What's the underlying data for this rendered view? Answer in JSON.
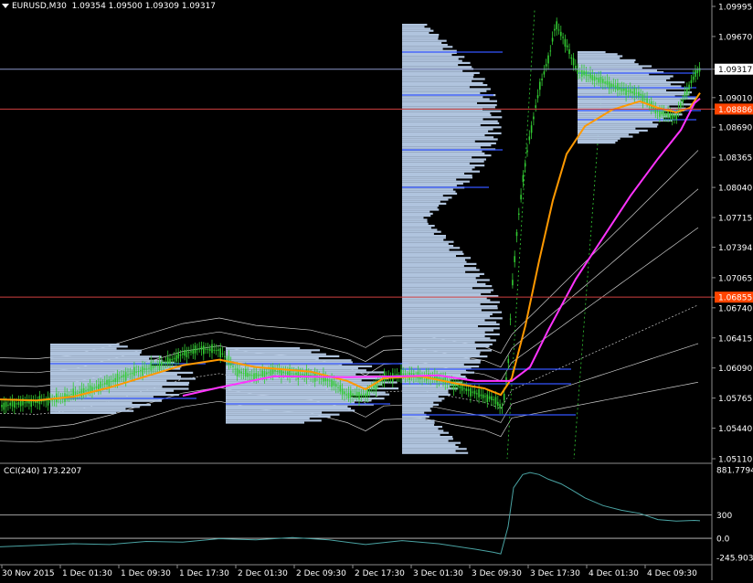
{
  "window": {
    "symbol": "EURUSD,M30",
    "ohlc": "1.09354 1.09500 1.09309 1.09317"
  },
  "indicator": {
    "title": "CCI(240) 173.2207"
  },
  "colors": {
    "background": "#000000",
    "bull_candle": "#33cc33",
    "profile_fill": "#b0c4de",
    "poc_line": "#3355ff",
    "orange_ma": "#ff9900",
    "magenta_ma": "#ff33ff",
    "horizontal_red": "#d04040",
    "current_price_line": "#8a96c8",
    "envelope": "#ffffff",
    "cci_line": "#4aa3a3",
    "red_label_bg": "#ff4400"
  },
  "chart_data": [
    {
      "type": "line",
      "name": "price-chart",
      "y_axis_ticks": [
        "1.09995",
        "1.09670",
        "1.09317",
        "1.09010",
        "1.08886",
        "1.08690",
        "1.08365",
        "1.08040",
        "1.07715",
        "1.07394",
        "1.07065",
        "1.06855",
        "1.06740",
        "1.06415",
        "1.06090",
        "1.05765",
        "1.05440",
        "1.05110"
      ],
      "highlighted_prices": {
        "current": "1.09317",
        "red_level_1": "1.08886",
        "red_level_2": "1.06855"
      },
      "x_axis_ticks": [
        "30 Nov 2015",
        "1 Dec 01:30",
        "1 Dec 09:30",
        "1 Dec 17:30",
        "2 Dec 01:30",
        "2 Dec 09:30",
        "2 Dec 17:30",
        "3 Dec 01:30",
        "3 Dec 09:30",
        "3 Dec 17:30",
        "4 Dec 01:30",
        "4 Dec 09:30"
      ],
      "ylim": [
        1.0511,
        1.09995
      ],
      "close_path": [
        [
          0,
          1.0568
        ],
        [
          20,
          1.0571
        ],
        [
          40,
          1.0573
        ],
        [
          60,
          1.0575
        ],
        [
          80,
          1.0581
        ],
        [
          100,
          1.0586
        ],
        [
          120,
          1.0594
        ],
        [
          140,
          1.0602
        ],
        [
          160,
          1.0608
        ],
        [
          180,
          1.0614
        ],
        [
          200,
          1.0624
        ],
        [
          220,
          1.063
        ],
        [
          240,
          1.0628
        ],
        [
          260,
          1.0605
        ],
        [
          280,
          1.06
        ],
        [
          300,
          1.0606
        ],
        [
          320,
          1.0603
        ],
        [
          340,
          1.0601
        ],
        [
          360,
          1.0596
        ],
        [
          380,
          1.058
        ],
        [
          400,
          1.058
        ],
        [
          420,
          1.0598
        ],
        [
          440,
          1.0602
        ],
        [
          460,
          1.06
        ],
        [
          480,
          1.0598
        ],
        [
          500,
          1.059
        ],
        [
          520,
          1.0582
        ],
        [
          540,
          1.0575
        ],
        [
          550,
          1.0566
        ],
        [
          556,
          1.061
        ],
        [
          560,
          1.069
        ],
        [
          566,
          1.076
        ],
        [
          572,
          1.081
        ],
        [
          578,
          1.085
        ],
        [
          584,
          1.088
        ],
        [
          590,
          1.091
        ],
        [
          596,
          1.093
        ],
        [
          602,
          1.095
        ],
        [
          608,
          1.098
        ],
        [
          614,
          1.097
        ],
        [
          620,
          1.0958
        ],
        [
          626,
          1.0942
        ],
        [
          632,
          1.093
        ],
        [
          680,
          1.091
        ],
        [
          700,
          1.0905
        ],
        [
          720,
          1.0885
        ],
        [
          740,
          1.088
        ],
        [
          750,
          1.0905
        ],
        [
          760,
          1.0925
        ],
        [
          766,
          1.0932
        ]
      ],
      "orange_ma": [
        [
          0,
          1.0575
        ],
        [
          40,
          1.0574
        ],
        [
          80,
          1.0578
        ],
        [
          120,
          1.0588
        ],
        [
          160,
          1.06
        ],
        [
          200,
          1.0612
        ],
        [
          240,
          1.0618
        ],
        [
          280,
          1.061
        ],
        [
          340,
          1.0605
        ],
        [
          380,
          1.0595
        ],
        [
          400,
          1.0586
        ],
        [
          420,
          1.0598
        ],
        [
          460,
          1.06
        ],
        [
          500,
          1.0592
        ],
        [
          530,
          1.0587
        ],
        [
          548,
          1.058
        ],
        [
          560,
          1.0598
        ],
        [
          575,
          1.0655
        ],
        [
          590,
          1.0725
        ],
        [
          605,
          1.079
        ],
        [
          620,
          1.084
        ],
        [
          640,
          1.087
        ],
        [
          670,
          1.0888
        ],
        [
          700,
          1.0897
        ],
        [
          720,
          1.089
        ],
        [
          740,
          1.0885
        ],
        [
          755,
          1.089
        ],
        [
          766,
          1.0906
        ]
      ],
      "magenta_ma": [
        [
          200,
          1.0579
        ],
        [
          240,
          1.0588
        ],
        [
          300,
          1.06
        ],
        [
          380,
          1.0599
        ],
        [
          440,
          1.06
        ],
        [
          480,
          1.0601
        ],
        [
          520,
          1.0595
        ],
        [
          560,
          1.0595
        ],
        [
          580,
          1.061
        ],
        [
          600,
          1.065
        ],
        [
          630,
          1.0705
        ],
        [
          660,
          1.075
        ],
        [
          690,
          1.0795
        ],
        [
          720,
          1.0835
        ],
        [
          745,
          1.0866
        ],
        [
          760,
          1.0895
        ],
        [
          766,
          1.09
        ]
      ]
    },
    {
      "type": "line",
      "name": "cci-chart",
      "title": "CCI(240) 173.2207",
      "y_axis_ticks": [
        "881.7794",
        "300",
        "0.0",
        "-245.9031"
      ],
      "ylim": [
        -245.9031,
        881.7794
      ],
      "values": [
        [
          0,
          -110
        ],
        [
          40,
          -90
        ],
        [
          80,
          -70
        ],
        [
          120,
          -80
        ],
        [
          160,
          -40
        ],
        [
          200,
          -50
        ],
        [
          240,
          -5
        ],
        [
          280,
          -20
        ],
        [
          320,
          10
        ],
        [
          360,
          -20
        ],
        [
          400,
          -80
        ],
        [
          440,
          -30
        ],
        [
          480,
          -70
        ],
        [
          520,
          -140
        ],
        [
          540,
          -180
        ],
        [
          548,
          -200
        ],
        [
          556,
          150
        ],
        [
          562,
          650
        ],
        [
          572,
          820
        ],
        [
          580,
          845
        ],
        [
          590,
          820
        ],
        [
          600,
          760
        ],
        [
          614,
          700
        ],
        [
          626,
          620
        ],
        [
          640,
          520
        ],
        [
          660,
          420
        ],
        [
          680,
          360
        ],
        [
          700,
          320
        ],
        [
          720,
          240
        ],
        [
          740,
          220
        ],
        [
          760,
          230
        ],
        [
          766,
          225
        ]
      ]
    }
  ]
}
